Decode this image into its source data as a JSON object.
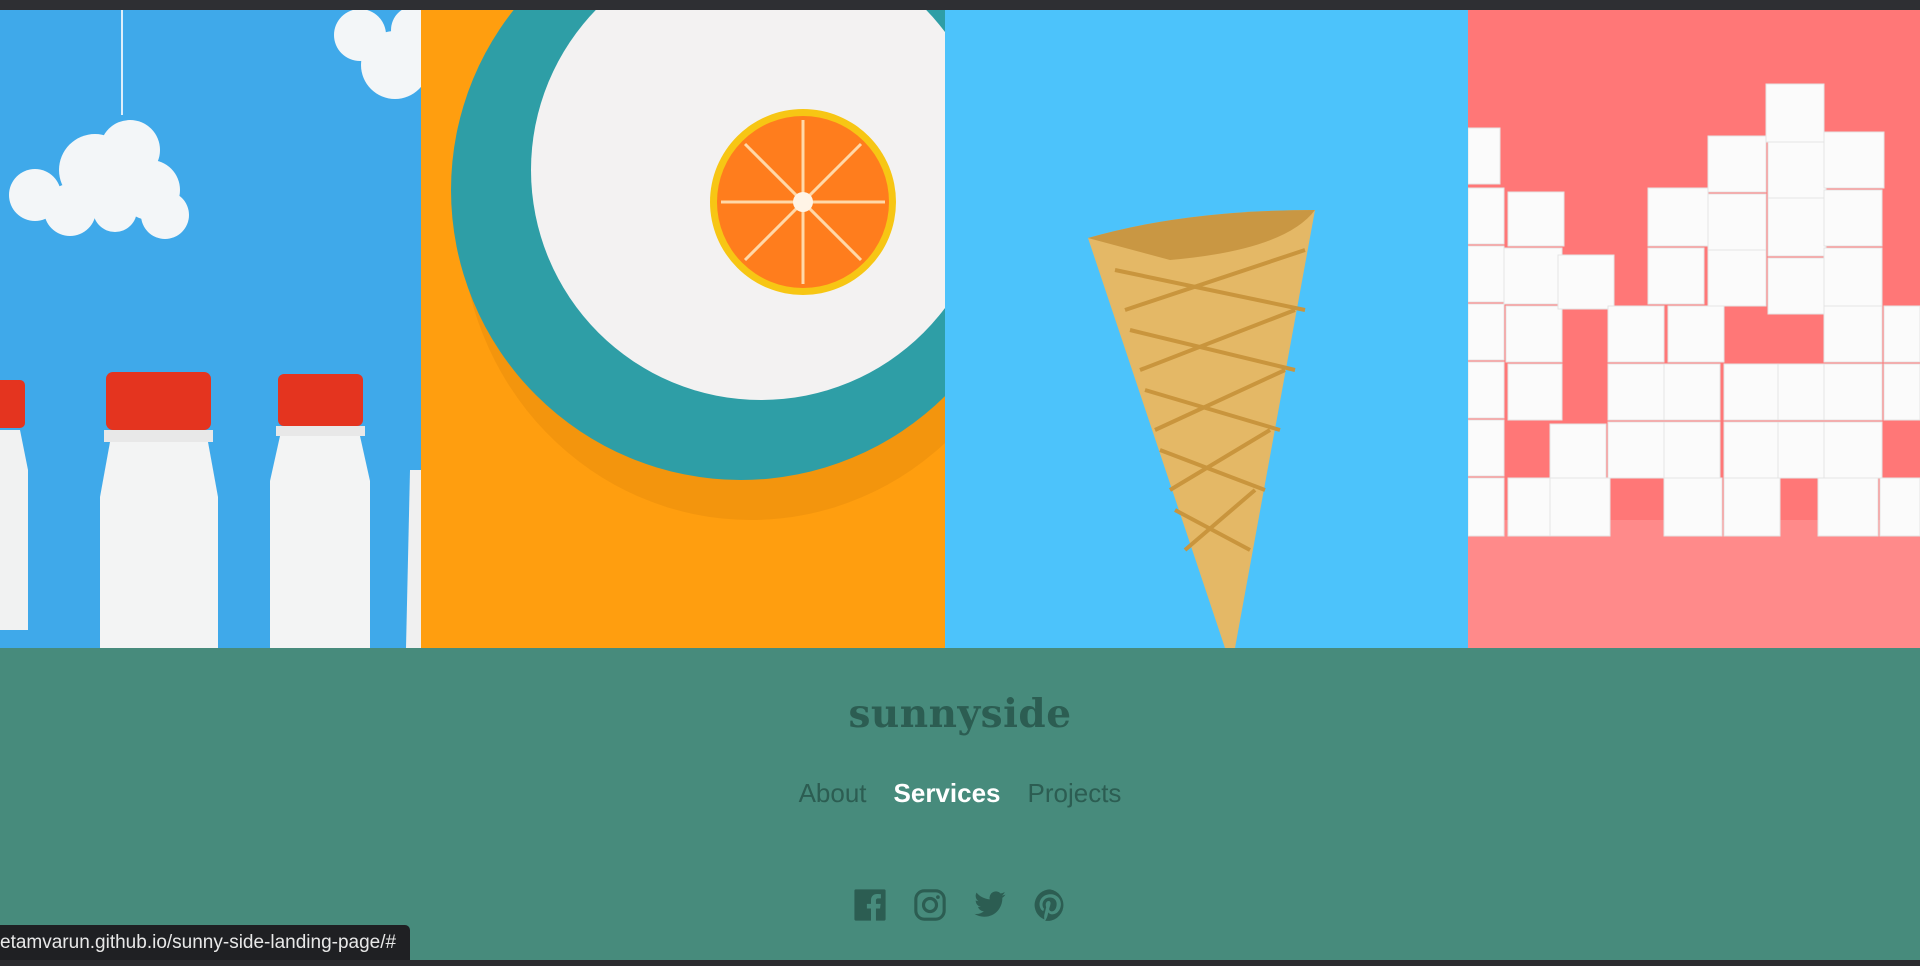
{
  "gallery": {
    "images": [
      {
        "name": "milk-bottles-image",
        "bg": "#3fa9ea"
      },
      {
        "name": "orange-plate-image",
        "bg": "#ff9e0f"
      },
      {
        "name": "ice-cream-cone-image",
        "bg": "#4cc3fb"
      },
      {
        "name": "sugar-cubes-image",
        "bg": "#ff7777"
      }
    ]
  },
  "footer": {
    "logo": "sunnyside",
    "nav": [
      "About",
      "Services",
      "Projects"
    ],
    "active_nav": "Services",
    "social_icons": [
      "facebook-icon",
      "instagram-icon",
      "twitter-icon",
      "pinterest-icon"
    ],
    "bg_color": "#478b7c",
    "text_color": "#2c5d52"
  },
  "status_bar": {
    "url": "etamvarun.github.io/sunny-side-landing-page/#"
  }
}
